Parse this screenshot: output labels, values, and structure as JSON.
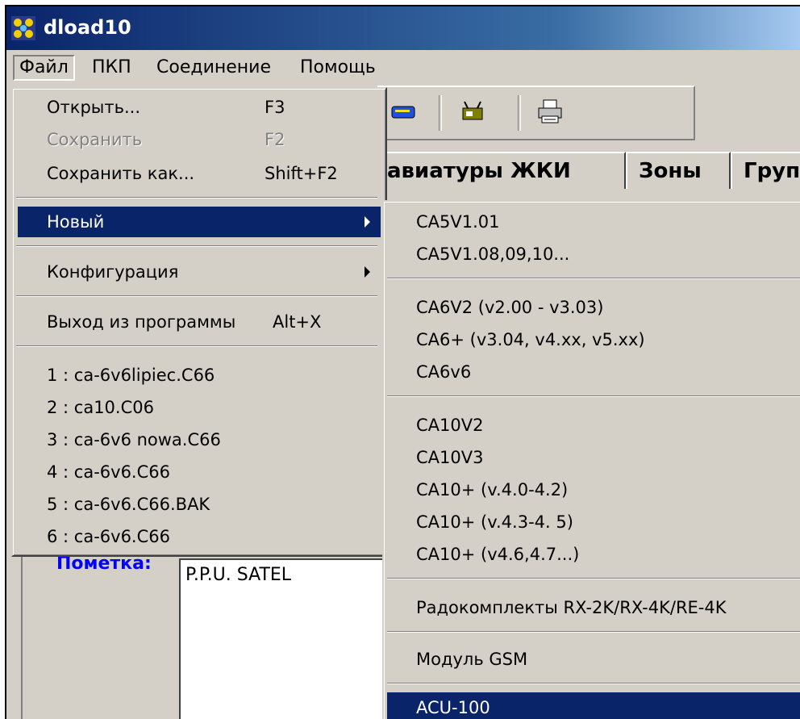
{
  "window": {
    "title": "dload10",
    "icon": "app-icon"
  },
  "menubar": {
    "items": [
      "Файл",
      "ПКП",
      "Соединение",
      "Помощь"
    ],
    "open_index": 0
  },
  "toolbar": {
    "icons": [
      "modem-icon",
      "device-icon",
      "printer-icon"
    ]
  },
  "tabs": [
    "авиатуры ЖКИ",
    "Зоны",
    "Груп"
  ],
  "note": {
    "label": "Пометка:",
    "value": "P.P.U. SATEL"
  },
  "file_menu": {
    "items": [
      {
        "label": "Открыть...",
        "shortcut": "F3",
        "disabled": false
      },
      {
        "label": "Сохранить",
        "shortcut": "F2",
        "disabled": true
      },
      {
        "label": "Сохранить как...",
        "shortcut": "Shift+F2",
        "disabled": false
      },
      {
        "label": "Новый",
        "highlighted": true,
        "submenu": true
      },
      {
        "label": "Конфигурация",
        "submenu": true
      },
      {
        "label": "Выход из программы",
        "shortcut": "Alt+X"
      },
      {
        "label": "1 : ca-6v6lipiec.C66"
      },
      {
        "label": "2 : ca10.C06"
      },
      {
        "label": "3 : ca-6v6 nowa.C66"
      },
      {
        "label": "4 : ca-6v6.C66"
      },
      {
        "label": "5 : ca-6v6.C66.BAK"
      },
      {
        "label": "6 : ca-6v6.C66"
      }
    ]
  },
  "new_submenu": {
    "items": [
      "CA5V1.01",
      "CA5V1.08,09,10...",
      "CA6V2 (v2.00 - v3.03)",
      "CA6+ (v3.04, v4.xx, v5.xx)",
      "CA6v6",
      "CA10V2",
      "CA10V3",
      "CA10+ (v.4.0-4.2)",
      "CA10+ (v.4.3-4. 5)",
      "CA10+ (v4.6,4.7...)",
      "Радокомплекты RX-2K/RX-4K/RE-4K",
      "Модуль GSM",
      "ACU-100"
    ],
    "highlighted_index": 12
  }
}
